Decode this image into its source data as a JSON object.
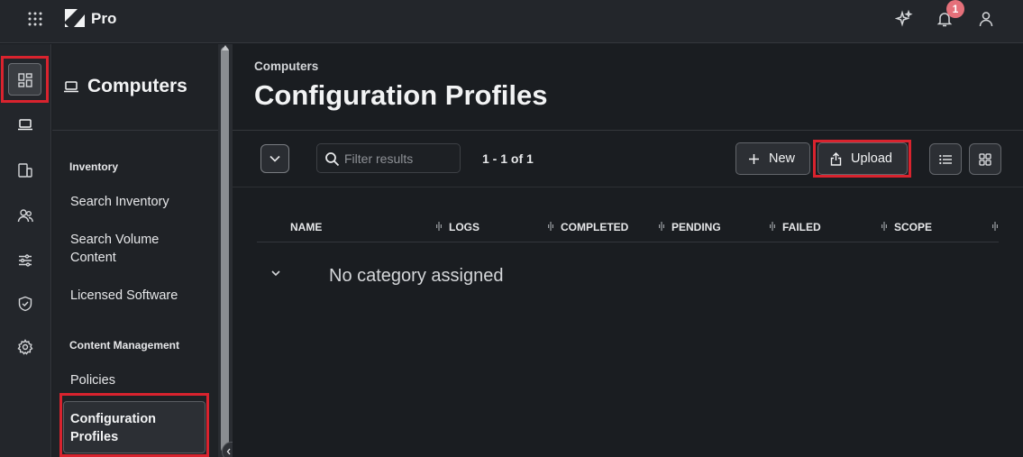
{
  "app": {
    "brand": "Pro",
    "notification_count": "1"
  },
  "sidebar": {
    "title": "Computers",
    "sections": [
      {
        "label": "Inventory",
        "items": [
          "Search Inventory",
          "Search Volume Content",
          "Licensed Software"
        ]
      },
      {
        "label": "Content Management",
        "items": [
          "Policies",
          "Configuration Profiles"
        ]
      }
    ],
    "selected": "Configuration Profiles"
  },
  "main": {
    "breadcrumb": "Computers",
    "title": "Configuration Profiles",
    "filter_placeholder": "Filter results",
    "count": "1 - 1 of 1",
    "new_label": "New",
    "upload_label": "Upload",
    "columns": [
      "NAME",
      "LOGS",
      "COMPLETED",
      "PENDING",
      "FAILED",
      "SCOPE"
    ],
    "rows": [
      {
        "label": "No category assigned"
      }
    ]
  },
  "icons": {
    "rail": [
      "dashboard-icon",
      "computer-icon",
      "mobile-devices-icon",
      "users-icon",
      "settings-sliders-icon",
      "shield-icon",
      "gear-icon"
    ],
    "top": [
      "app-grid-icon",
      "sparkle-icon",
      "bell-icon",
      "user-icon"
    ]
  },
  "colors": {
    "highlight": "#d9232e",
    "badge": "#e5707a",
    "background": "#1a1d21"
  }
}
